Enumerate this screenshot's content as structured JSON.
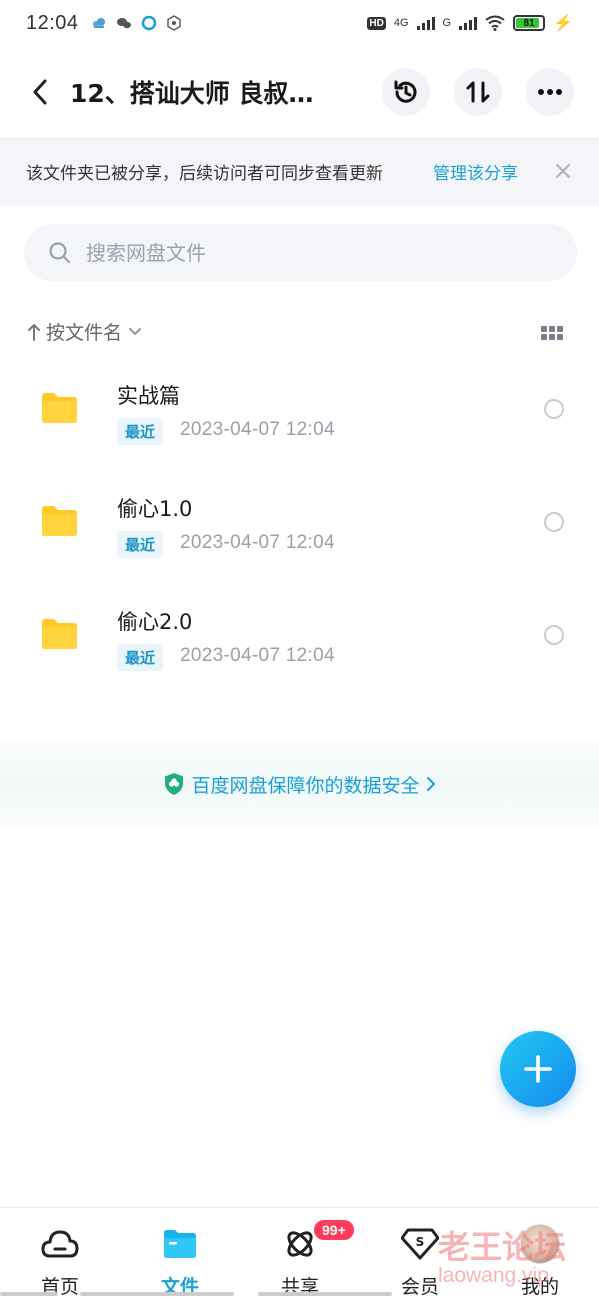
{
  "status_bar": {
    "time": "12:04",
    "hd": "HD",
    "net1": "4G",
    "net2": "G",
    "battery": "81"
  },
  "header": {
    "title": "12、搭讪大师 良叔…"
  },
  "notice": {
    "text": "该文件夹已被分享，后续访问者可同步查看更新",
    "link": "管理该分享"
  },
  "search": {
    "placeholder": "搜索网盘文件"
  },
  "sort": {
    "label": "按文件名"
  },
  "files": [
    {
      "name": "实战篇",
      "badge": "最近",
      "date": "2023-04-07  12:04"
    },
    {
      "name": "偷心1.0",
      "badge": "最近",
      "date": "2023-04-07  12:04"
    },
    {
      "name": "偷心2.0",
      "badge": "最近",
      "date": "2023-04-07  12:04"
    }
  ],
  "security": {
    "text": "百度网盘保障你的数据安全"
  },
  "tabs": [
    {
      "label": "首页"
    },
    {
      "label": "文件"
    },
    {
      "label": "共享"
    },
    {
      "label": "会员"
    },
    {
      "label": "我的"
    }
  ],
  "share_badge": "99+",
  "watermark": {
    "main": "老王论坛",
    "sub": "laowang.vip"
  },
  "colors": {
    "accent": "#1aa0d8",
    "folder": "#ffc926",
    "badge": "#ff3b5c"
  }
}
